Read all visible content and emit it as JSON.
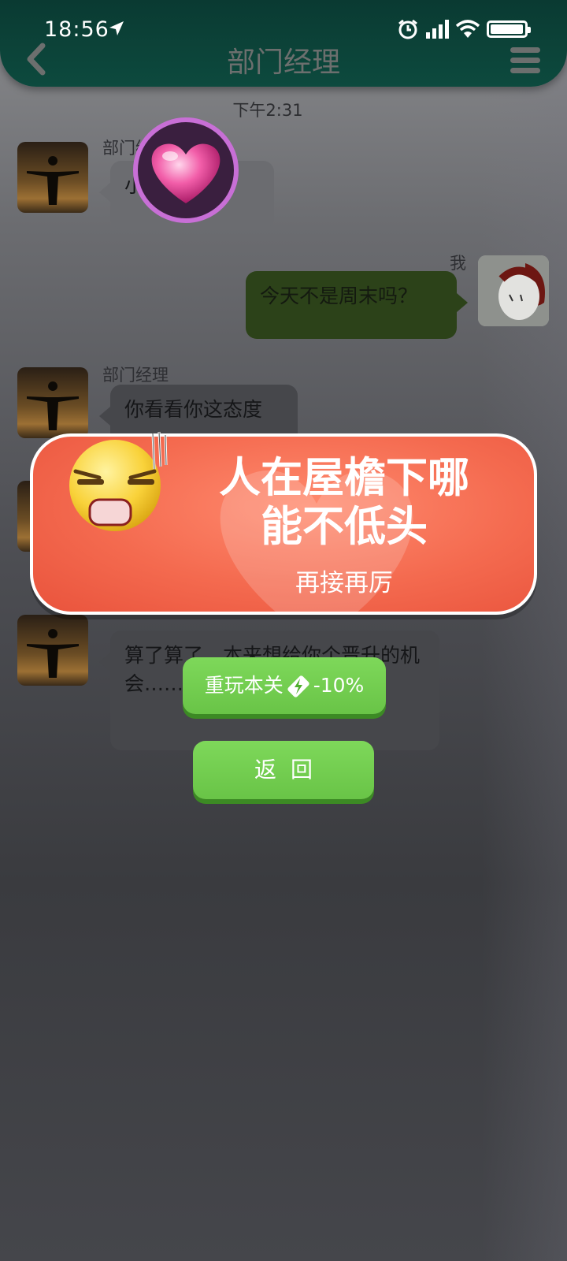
{
  "status_bar": {
    "time": "18:56"
  },
  "header": {
    "title": "部门经理"
  },
  "chat": {
    "timestamp": "下午2:31",
    "messages": [
      {
        "sender": "部门经理",
        "text": "小李，在吗？"
      },
      {
        "sender": "我",
        "text": "今天不是周末吗？"
      },
      {
        "sender": "部门经理",
        "text": "你看看你这态度"
      },
      {
        "sender": "部门经理",
        "text": "算了算了，本来想给你个晋升的机会……看来你没有这个觉悟"
      }
    ]
  },
  "result_banner": {
    "title_line1": "人在屋檐下哪",
    "title_line2": "能不低头",
    "subtitle": "再接再厉"
  },
  "buttons": {
    "replay_label": "重玩本关",
    "replay_cost": "-10%",
    "back_label": "返回"
  },
  "colors": {
    "header_bg": "#0d4a3e",
    "banner_red": "#f46a4f",
    "button_green": "#6fcb4b"
  },
  "icons": [
    "location-arrow-icon",
    "alarm-icon",
    "signal-icon",
    "wifi-icon",
    "battery-icon",
    "back-arrow-icon",
    "menu-icon",
    "heart-icon",
    "angry-emoji-icon",
    "stamina-icon"
  ]
}
